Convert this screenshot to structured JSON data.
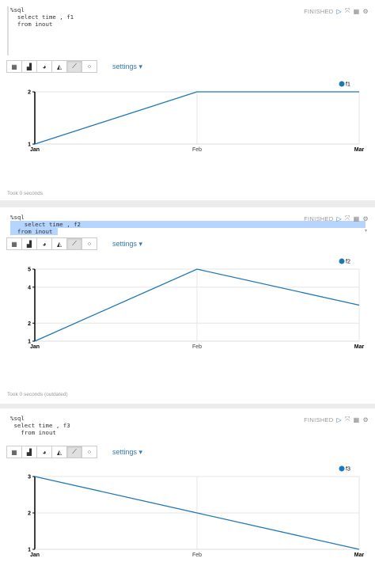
{
  "paragraphs": [
    {
      "code": [
        "%sql",
        "  select time , f1",
        "  from inout"
      ],
      "status": "FINISHED",
      "settings_label": "settings",
      "took": "Took 0 seconds",
      "chart_data": {
        "type": "line",
        "categories": [
          "Jan",
          "Feb",
          "Mar"
        ],
        "series": [
          {
            "name": "f1",
            "values": [
              1,
              2,
              2
            ],
            "color": "#1f77b4"
          }
        ],
        "yticks": [
          1,
          2
        ],
        "ylim": [
          1,
          2
        ],
        "grid": true,
        "legend": "top-right"
      }
    },
    {
      "code": [
        "%sql",
        "    select time , f2",
        "  from inout"
      ],
      "status": "FINISHED",
      "settings_label": "settings",
      "took": "Took 0 seconds (outdated)",
      "chart_data": {
        "type": "line",
        "categories": [
          "Jan",
          "Feb",
          "Mar"
        ],
        "series": [
          {
            "name": "f2",
            "values": [
              1,
              5,
              3
            ],
            "color": "#1f77b4"
          }
        ],
        "yticks": [
          1,
          2,
          4,
          5
        ],
        "ylim": [
          1,
          5
        ],
        "grid": true,
        "legend": "top-right"
      }
    },
    {
      "code": [
        "%sql",
        " select time , f3",
        "   from inout"
      ],
      "status": "FINISHED",
      "settings_label": "settings",
      "took": "",
      "chart_data": {
        "type": "line",
        "categories": [
          "Jan",
          "Feb",
          "Mar"
        ],
        "series": [
          {
            "name": "f3",
            "values": [
              3,
              2,
              1
            ],
            "color": "#1f77b4"
          }
        ],
        "yticks": [
          1,
          2,
          3
        ],
        "ylim": [
          1,
          3
        ],
        "grid": true,
        "legend": "top-right"
      }
    }
  ],
  "icons": {
    "status": [
      "run-icon",
      "expand-icon",
      "table-icon",
      "gear-icon"
    ],
    "viz": [
      "table-view-icon",
      "bar-chart-icon",
      "pie-chart-icon",
      "area-chart-icon",
      "line-chart-icon",
      "scatter-chart-icon"
    ]
  }
}
